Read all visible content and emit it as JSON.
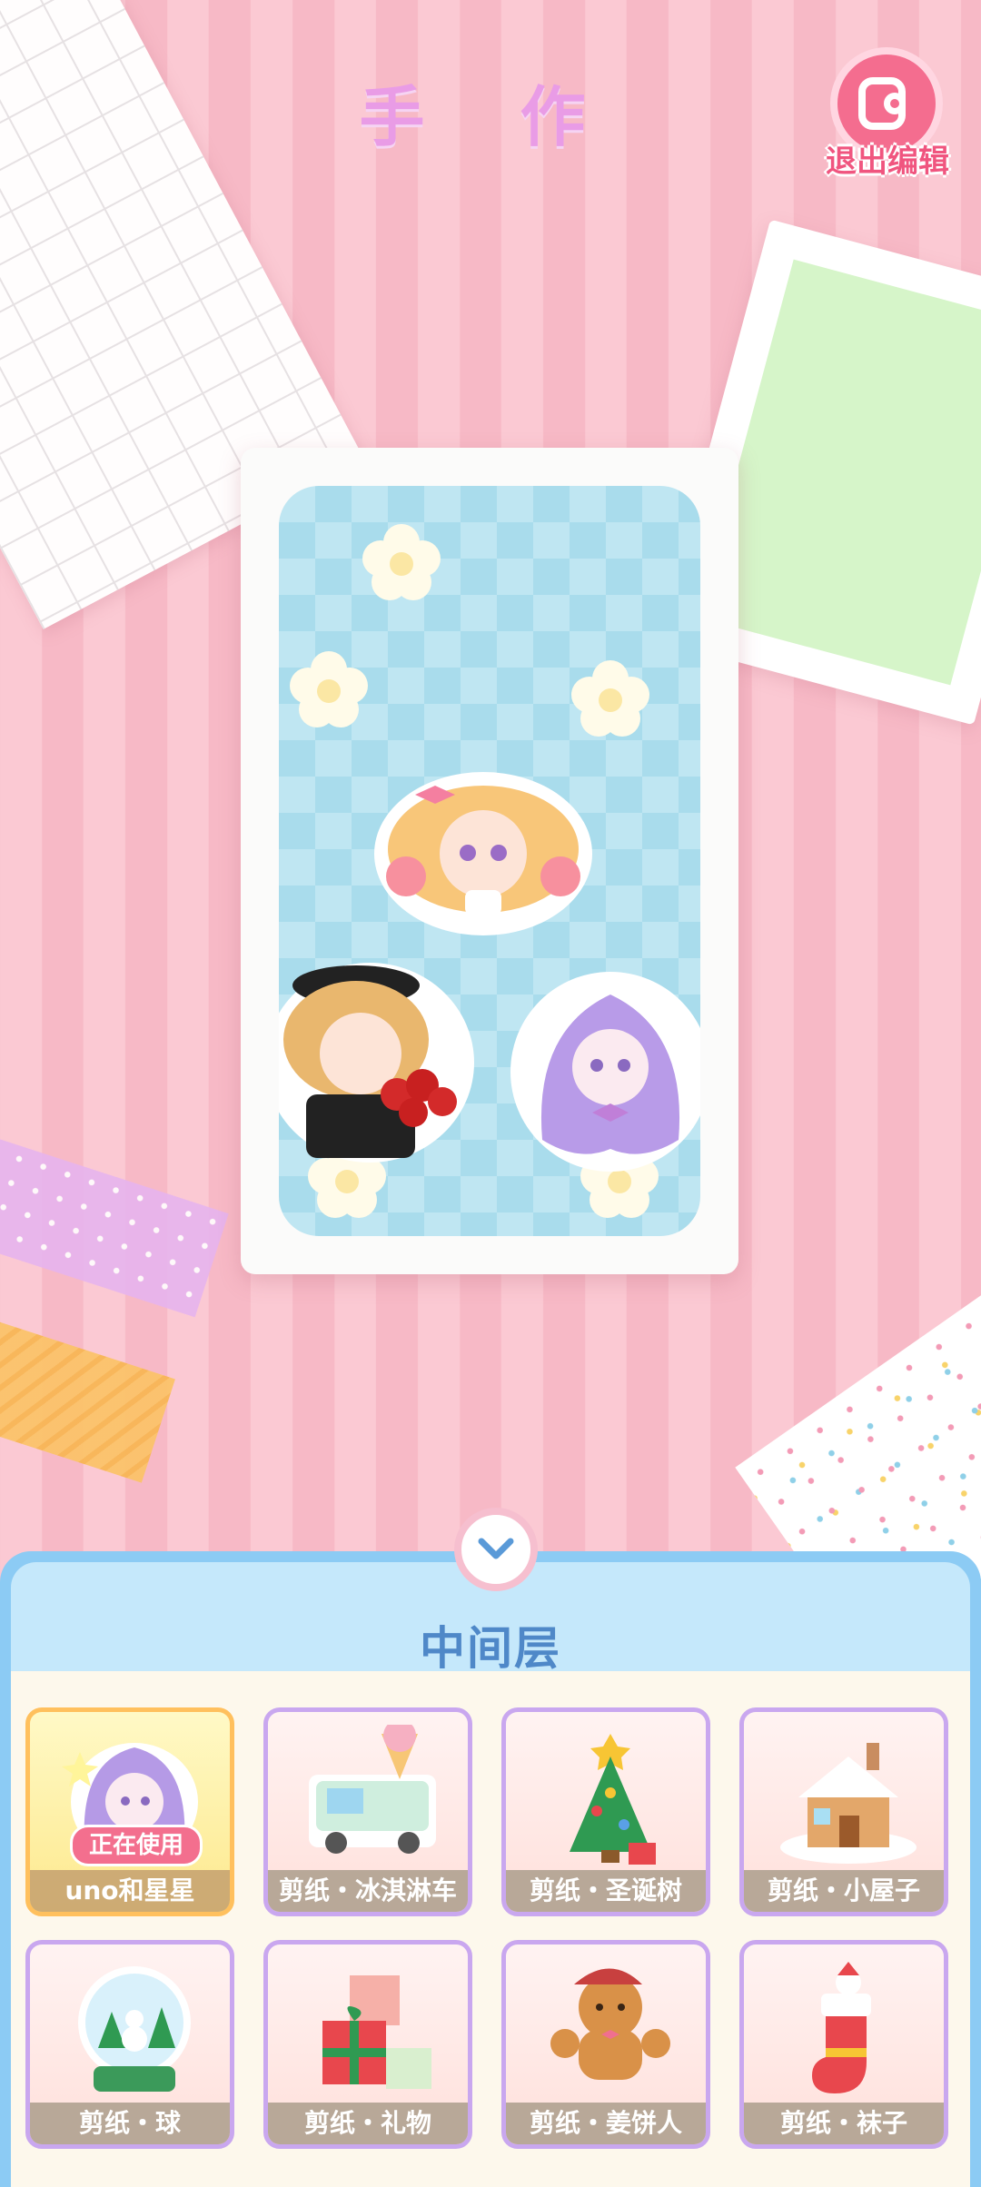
{
  "header": {
    "title": "手 作",
    "exit_label": "退出编辑"
  },
  "panel": {
    "title": "中间层",
    "in_use_label": "正在使用",
    "items": [
      {
        "label": "uno和星星",
        "icon": "uno-star-sticker-icon",
        "active": true
      },
      {
        "label": "剪纸・冰淇淋车",
        "icon": "ice-cream-truck-icon",
        "active": false
      },
      {
        "label": "剪纸・圣诞树",
        "icon": "christmas-tree-icon",
        "active": false
      },
      {
        "label": "剪纸・小屋子",
        "icon": "snow-house-icon",
        "active": false
      },
      {
        "label": "剪纸・球",
        "icon": "snow-globe-icon",
        "active": false
      },
      {
        "label": "剪纸・礼物",
        "icon": "gift-boxes-icon",
        "active": false
      },
      {
        "label": "剪纸・姜饼人",
        "icon": "gingerbread-man-icon",
        "active": false
      },
      {
        "label": "剪纸・袜子",
        "icon": "christmas-stocking-icon",
        "active": false
      }
    ]
  },
  "colors": {
    "title": "#e99ce6",
    "accent_pink": "#f46d8f",
    "panel_blue": "#8ccbf4",
    "item_border": "#c9a7ef",
    "active_border": "#ffc05d"
  }
}
